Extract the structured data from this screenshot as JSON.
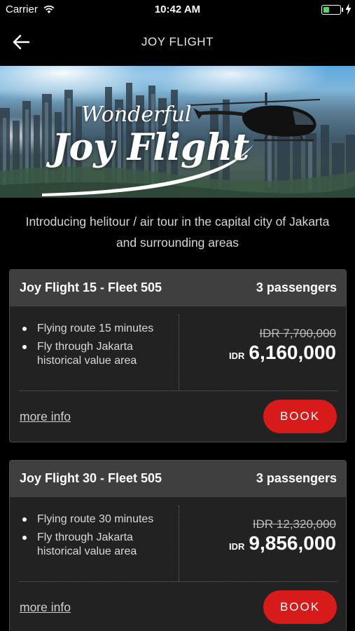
{
  "status_bar": {
    "carrier": "Carrier",
    "time": "10:42 AM",
    "battery_color": "#4cd964"
  },
  "nav": {
    "title": "JOY FLIGHT",
    "back_icon": "arrow-left-icon"
  },
  "hero": {
    "title_line1": "Wonderful",
    "title_line2": "Joy Flight"
  },
  "intro": "Introducing helitour / air tour in the capital city of Jakarta and surrounding areas",
  "packages": [
    {
      "title": "Joy Flight 15 - Fleet 505",
      "passengers": "3 passengers",
      "features": [
        "Flying route 15 minutes",
        "Fly through Jakarta historical value area"
      ],
      "original_price": "IDR 7,700,000",
      "currency": "IDR",
      "price": "6,160,000",
      "more_info_label": "more info",
      "book_label": "BOOK"
    },
    {
      "title": "Joy Flight 30 - Fleet 505",
      "passengers": "3 passengers",
      "features": [
        "Flying route 30 minutes",
        "Fly through Jakarta historical value area"
      ],
      "original_price": "IDR 12,320,000",
      "currency": "IDR",
      "price": "9,856,000",
      "more_info_label": "more info",
      "book_label": "BOOK"
    }
  ],
  "colors": {
    "accent": "#d71a1a",
    "card_header": "#3f3f3f",
    "card_body": "#222222",
    "background": "#000000"
  }
}
